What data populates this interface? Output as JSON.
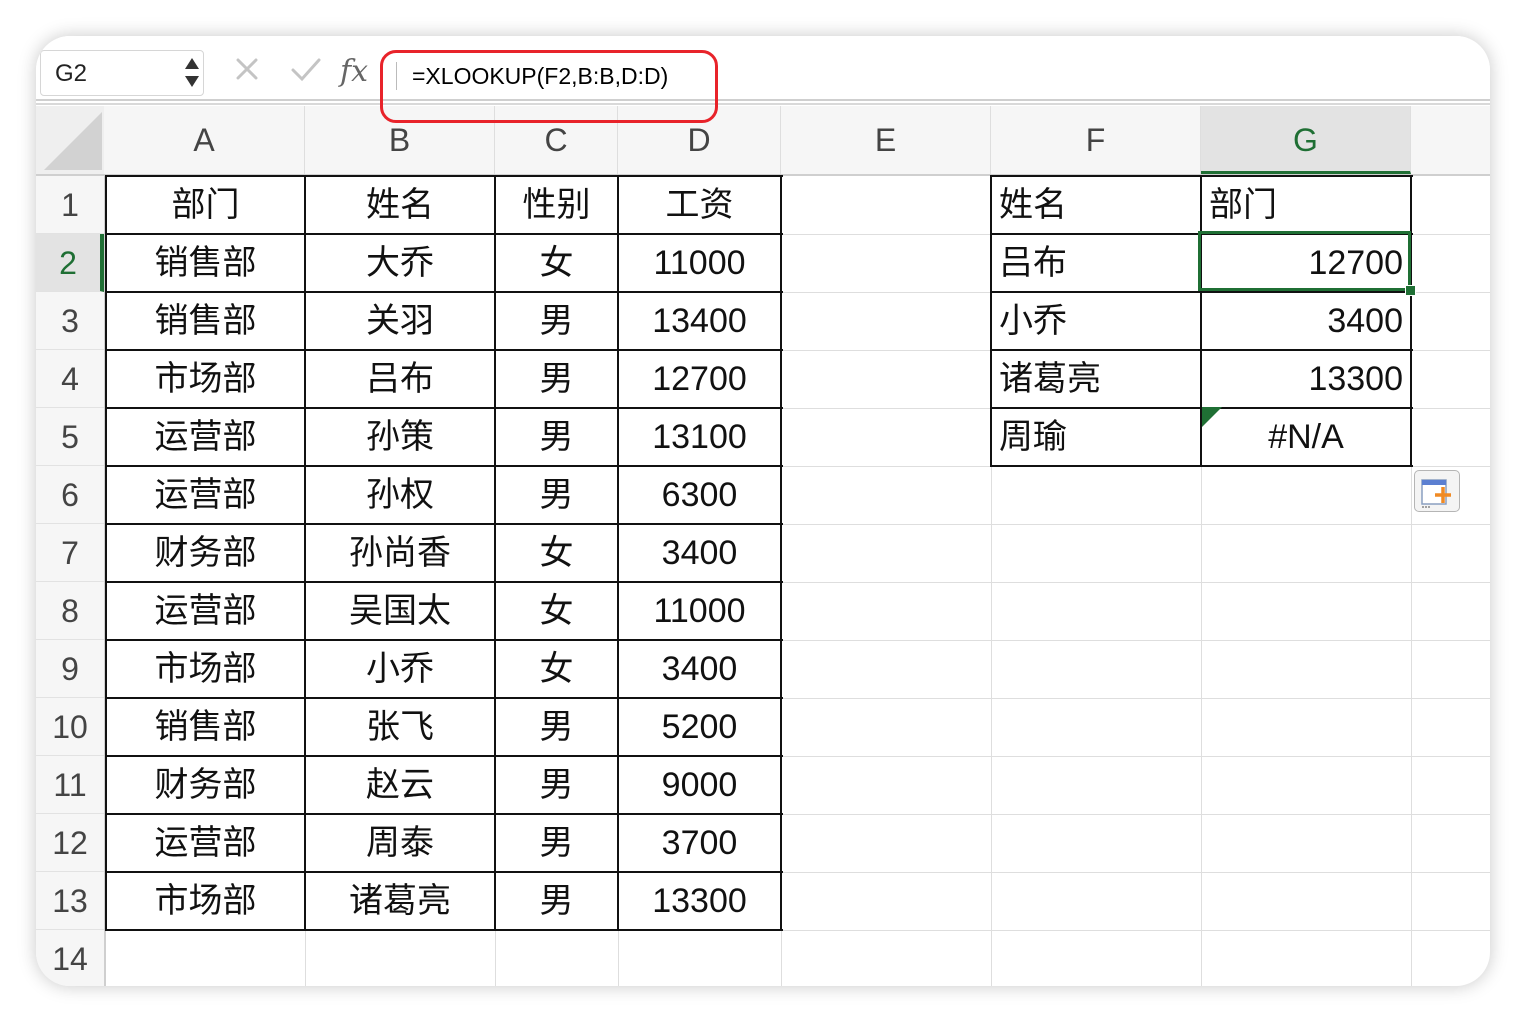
{
  "formula_bar": {
    "name_box": "G2",
    "formula": "=XLOOKUP(F2,B:B,D:D)",
    "fx_label": "fx"
  },
  "columns": [
    "A",
    "B",
    "C",
    "D",
    "E",
    "F",
    "G"
  ],
  "row_numbers": [
    "1",
    "2",
    "3",
    "4",
    "5",
    "6",
    "7",
    "8",
    "9",
    "10",
    "11",
    "12",
    "13",
    "14"
  ],
  "main_table": {
    "headers": [
      "部门",
      "姓名",
      "性别",
      "工资"
    ],
    "rows": [
      [
        "销售部",
        "大乔",
        "女",
        "11000"
      ],
      [
        "销售部",
        "关羽",
        "男",
        "13400"
      ],
      [
        "市场部",
        "吕布",
        "男",
        "12700"
      ],
      [
        "运营部",
        "孙策",
        "男",
        "13100"
      ],
      [
        "运营部",
        "孙权",
        "男",
        "6300"
      ],
      [
        "财务部",
        "孙尚香",
        "女",
        "3400"
      ],
      [
        "运营部",
        "吴国太",
        "女",
        "11000"
      ],
      [
        "市场部",
        "小乔",
        "女",
        "3400"
      ],
      [
        "销售部",
        "张飞",
        "男",
        "5200"
      ],
      [
        "财务部",
        "赵云",
        "男",
        "9000"
      ],
      [
        "运营部",
        "周泰",
        "男",
        "3700"
      ],
      [
        "市场部",
        "诸葛亮",
        "男",
        "13300"
      ]
    ]
  },
  "lookup_table": {
    "headers": [
      "姓名",
      "部门"
    ],
    "rows": [
      [
        "吕布",
        "12700"
      ],
      [
        "小乔",
        "3400"
      ],
      [
        "诸葛亮",
        "13300"
      ],
      [
        "周瑜",
        "#N/A"
      ]
    ]
  },
  "selection": {
    "cell": "G2",
    "column": "G",
    "row": "2"
  },
  "colors": {
    "accent": "#1f6f34",
    "highlight_box": "#e8232a",
    "paste_icon_plus": "#f08a24"
  },
  "icons": [
    "cancel-icon",
    "confirm-icon",
    "function-icon",
    "paste-options-icon"
  ]
}
